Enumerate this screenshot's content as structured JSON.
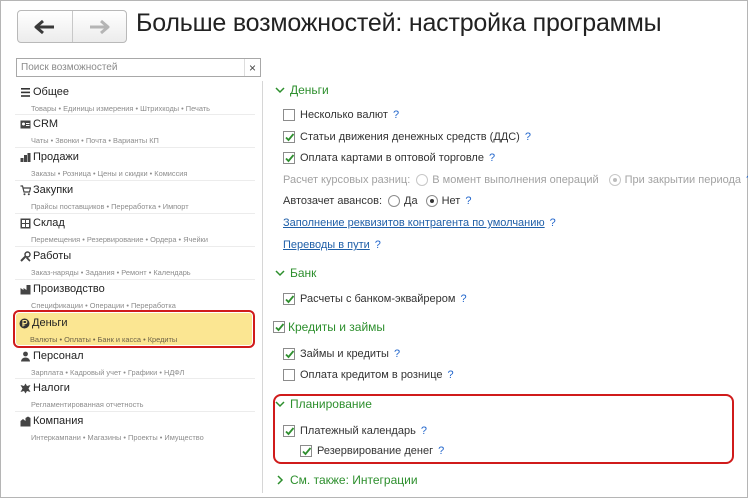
{
  "header": {
    "title": "Больше возможностей: настройка программы",
    "back_icon": "arrow-left-icon",
    "forward_icon": "arrow-right-icon"
  },
  "search": {
    "placeholder": "Поиск возможностей",
    "clear_icon": "close-icon"
  },
  "sidebar": {
    "active_index": 7,
    "items": [
      {
        "label": "Общее",
        "sub": "Товары • Единицы измерения • Штрихкоды • Печать",
        "icon": "list-icon"
      },
      {
        "label": "CRM",
        "sub": "Чаты • Звонки • Почта • Варианты КП",
        "icon": "contact-card-icon"
      },
      {
        "label": "Продажи",
        "sub": "Заказы • Розница • Цены и скидки • Комиссия",
        "icon": "sales-icon"
      },
      {
        "label": "Закупки",
        "sub": "Прайсы поставщиков • Переработка • Импорт",
        "icon": "purchases-icon"
      },
      {
        "label": "Склад",
        "sub": "Перемещения • Резервирование • Ордера • Ячейки",
        "icon": "warehouse-icon"
      },
      {
        "label": "Работы",
        "sub": "Заказ-наряды • Задания • Ремонт • Календарь",
        "icon": "tools-icon"
      },
      {
        "label": "Производство",
        "sub": "Спецификации • Операции • Переработка",
        "icon": "factory-icon"
      },
      {
        "label": "Деньги",
        "sub": "Валюты • Оплаты • Банк и касса • Кредиты",
        "icon": "ruble-coin-icon"
      },
      {
        "label": "Персонал",
        "sub": "Зарплата • Кадровый учет • Графики • НДФЛ",
        "icon": "person-icon"
      },
      {
        "label": "Налоги",
        "sub": "Регламентированная отчетность",
        "icon": "emblem-icon"
      },
      {
        "label": "Компания",
        "sub": "Интеркампани • Магазины • Проекты • Имущество",
        "icon": "company-icon"
      }
    ]
  },
  "panel": {
    "money": {
      "title": "Деньги",
      "multi_currency": {
        "label": "Несколько валют",
        "checked": false,
        "help": "?"
      },
      "cash_flow_items": {
        "label": "Статьи движения денежных средств (ДДС)",
        "checked": true,
        "help": "?"
      },
      "card_payment": {
        "label": "Оплата картами в оптовой торговле",
        "checked": true,
        "help": "?"
      },
      "fx_diff": {
        "label": "Расчет курсовых разниц:",
        "option1": "В момент выполнения операций",
        "option2": "При закрытии периода",
        "selected": "option2",
        "help": "?"
      },
      "auto_advance": {
        "label": "Автозачет авансов:",
        "option_yes": "Да",
        "option_no": "Нет",
        "selected": "no",
        "help": "?"
      },
      "counterparty_link": "Заполнение реквизитов контрагента по умолчанию",
      "counterparty_help": "?",
      "transit_link": "Переводы в пути",
      "transit_help": "?"
    },
    "bank": {
      "title": "Банк",
      "acquiring": {
        "label": "Расчеты с банком-эквайрером",
        "checked": true,
        "help": "?"
      }
    },
    "credits": {
      "title": "Кредиты и займы",
      "loans": {
        "label": "Займы и кредиты",
        "checked": true,
        "help": "?"
      },
      "retail_credit": {
        "label": "Оплата кредитом в рознице",
        "checked": false,
        "help": "?"
      }
    },
    "planning": {
      "title": "Планирование",
      "payment_calendar": {
        "label": "Платежный календарь",
        "checked": true,
        "help": "?"
      },
      "money_reserve": {
        "label": "Резервирование денег",
        "checked": true,
        "help": "?"
      }
    },
    "see_also": {
      "title": "См. также: Интеграции"
    }
  },
  "colors": {
    "group_title": "#2d8f2d",
    "link": "#1f5fa8",
    "help": "#2266cc",
    "active_bg": "#fbe692",
    "highlight_border": "#d01b1b"
  }
}
